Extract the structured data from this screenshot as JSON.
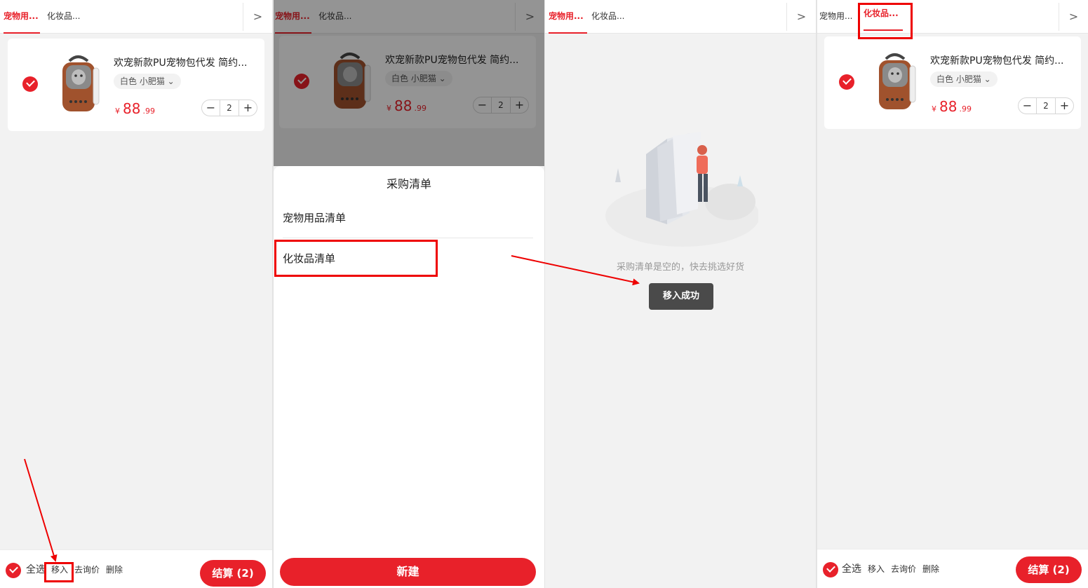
{
  "tabs": {
    "pet_list": "宠物用...",
    "cosmetics_list": "化妆品...",
    "more": ">"
  },
  "product": {
    "title": "欢宠新款PU宠物包代发 简约...",
    "spec": "白色 小肥猫",
    "spec_chevron": "⌄",
    "currency": "¥",
    "price_int": "88",
    "price_dec": ".99",
    "quantity": "2",
    "minus": "−",
    "plus": "+"
  },
  "bottom_bar": {
    "select_all": "全选",
    "move_in": "移入",
    "inquire": "去询价",
    "delete": "删除",
    "settle": "结算 (2)"
  },
  "sheet": {
    "title": "采购清单",
    "item_pet": "宠物用品清单",
    "item_cosmetics": "化妆品清单",
    "new_button": "新建"
  },
  "empty_state": {
    "message": "采购清单是空的，快去挑选好货"
  },
  "toast": {
    "message": "移入成功"
  },
  "colors": {
    "accent": "#e8212a",
    "annotation": "#e00000"
  }
}
